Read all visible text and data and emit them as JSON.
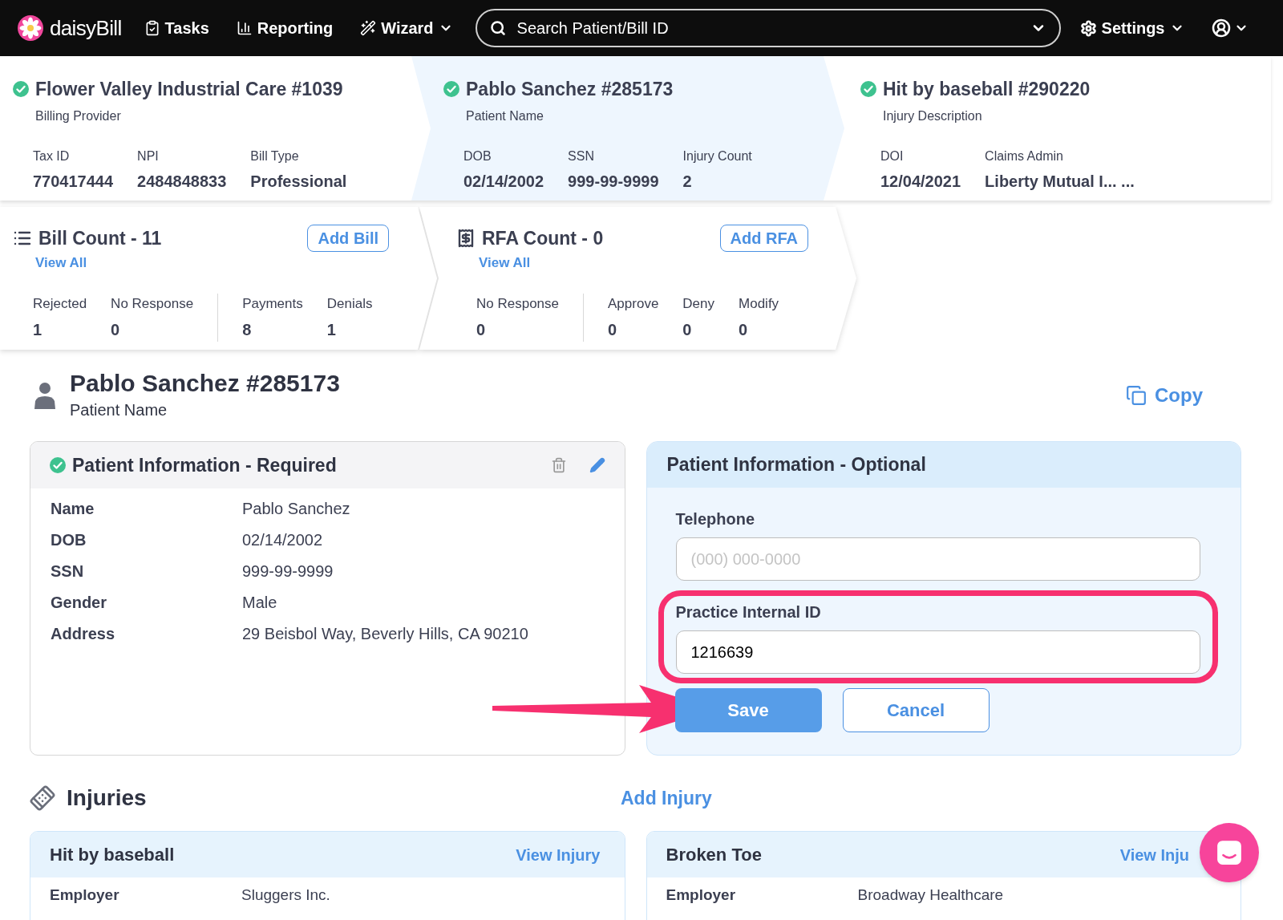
{
  "nav": {
    "logo": "daisyBill",
    "items": [
      {
        "label": "Tasks",
        "kind": "tasks",
        "dropdown": false
      },
      {
        "label": "Reporting",
        "kind": "reporting",
        "dropdown": false
      },
      {
        "label": "Wizard",
        "kind": "wizard",
        "dropdown": true
      }
    ],
    "search": {
      "placeholder": "Search Patient/Bill ID"
    },
    "settings": "Settings"
  },
  "steps": [
    {
      "title": "Flower Valley Industrial Care #1039",
      "subtitle": "Billing Provider",
      "complete": true,
      "selected": false,
      "fields": [
        {
          "label": "Tax ID",
          "value": "770417444"
        },
        {
          "label": "NPI",
          "value": "2484848833"
        },
        {
          "label": "Bill Type",
          "value": "Professional"
        }
      ]
    },
    {
      "title": "Pablo Sanchez #285173",
      "subtitle": "Patient Name",
      "complete": true,
      "selected": true,
      "fields": [
        {
          "label": "DOB",
          "value": "02/14/2002"
        },
        {
          "label": "SSN",
          "value": "999-99-9999"
        },
        {
          "label": "Injury Count",
          "value": "2"
        }
      ]
    },
    {
      "title": "Hit by baseball #290220",
      "subtitle": "Injury Description",
      "complete": true,
      "selected": false,
      "fields": [
        {
          "label": "DOI",
          "value": "12/04/2021"
        },
        {
          "label": "Claims Admin",
          "value": "Liberty Mutual I... ..."
        }
      ]
    }
  ],
  "counts": [
    {
      "kind": "bill",
      "title": "Bill Count - 11",
      "button": "Add Bill",
      "link": "View All",
      "groups": [
        [
          {
            "label": "Rejected",
            "value": "1"
          },
          {
            "label": "No Response",
            "value": "0"
          }
        ],
        [
          {
            "label": "Payments",
            "value": "8"
          },
          {
            "label": "Denials",
            "value": "1"
          }
        ]
      ]
    },
    {
      "kind": "rfa",
      "title": "RFA Count - 0",
      "button": "Add RFA",
      "link": "View All",
      "groups": [
        [
          {
            "label": "No Response",
            "value": "0"
          }
        ],
        [
          {
            "label": "Approve",
            "value": "0"
          },
          {
            "label": "Deny",
            "value": "0"
          },
          {
            "label": "Modify",
            "value": "0"
          }
        ]
      ]
    }
  ],
  "patient": {
    "name": "Pablo Sanchez #285173",
    "subtitle": "Patient Name",
    "copy": "Copy"
  },
  "required": {
    "title": "Patient Information - Required",
    "complete": true,
    "rows": [
      {
        "label": "Name",
        "value": "Pablo Sanchez"
      },
      {
        "label": "DOB",
        "value": "02/14/2002"
      },
      {
        "label": "SSN",
        "value": "999-99-9999"
      },
      {
        "label": "Gender",
        "value": "Male"
      },
      {
        "label": "Address",
        "value": "29 Beisbol Way, Beverly Hills, CA 90210"
      }
    ]
  },
  "optional": {
    "title": "Patient Information - Optional",
    "fields": [
      {
        "label": "Telephone",
        "placeholder": "(000) 000-0000",
        "highlighted": false
      },
      {
        "label": "Practice Internal ID",
        "value": "1216639",
        "highlighted": true
      }
    ],
    "buttons": [
      {
        "label": "Save",
        "kind": "primary",
        "pointed": true
      },
      {
        "label": "Cancel",
        "kind": "secondary",
        "pointed": false
      }
    ]
  },
  "injuries": {
    "title": "Injuries",
    "add": "Add Injury",
    "cards": [
      {
        "title": "Hit by baseball",
        "link": "View Injury",
        "rows": [
          {
            "label": "Employer",
            "value": "Sluggers Inc."
          }
        ]
      },
      {
        "title": "Broken Toe",
        "link": "View Inju",
        "rows": [
          {
            "label": "Employer",
            "value": "Broadway Healthcare"
          }
        ]
      }
    ]
  }
}
